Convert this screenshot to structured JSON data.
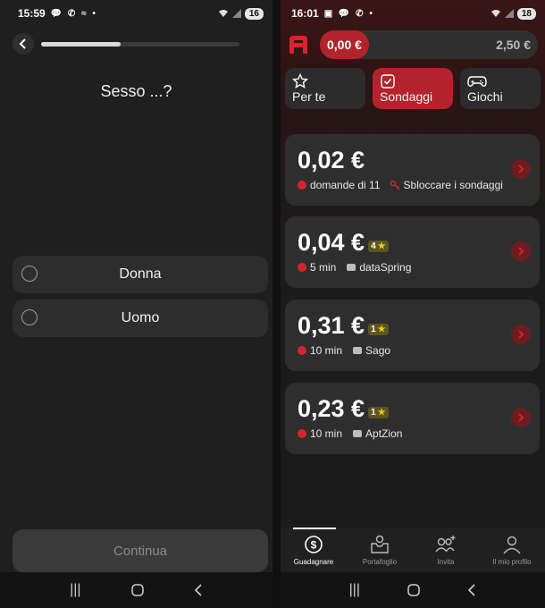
{
  "left_screen": {
    "status_bar": {
      "time": "15:59",
      "notifications": "💬 ✆ ≈ •",
      "battery": "16"
    },
    "progress_percent": 40,
    "question": "Sesso ...?",
    "options": [
      {
        "label": "Donna"
      },
      {
        "label": "Uomo"
      }
    ],
    "continue_label": "Continua"
  },
  "right_screen": {
    "status_bar": {
      "time": "16:01",
      "notifications": "▣ 💬 ✆ •",
      "battery": "18"
    },
    "balance_main": "0,00 €",
    "balance_secondary": "2,50 €",
    "tabs": [
      {
        "label": "Per te",
        "icon": "star-icon"
      },
      {
        "label": "Sondaggi",
        "icon": "checkbox-icon"
      },
      {
        "label": "Giochi",
        "icon": "gamepad-icon"
      }
    ],
    "surveys": [
      {
        "amount": "0,02 €",
        "meta1": "domande di 11",
        "meta2": "Sbloccare i sondaggi"
      },
      {
        "amount": "0,04 €",
        "rating": "4",
        "duration": "5 min",
        "provider": "dataSpring"
      },
      {
        "amount": "0,31 €",
        "rating": "1",
        "duration": "10 min",
        "provider": "Sago"
      },
      {
        "amount": "0,23 €",
        "rating": "1",
        "duration": "10 min",
        "provider": "AptZion"
      }
    ],
    "bottom_nav": [
      {
        "label": "Guadagnare"
      },
      {
        "label": "Portafoglio"
      },
      {
        "label": "Invita"
      },
      {
        "label": "Il mio profilo"
      }
    ]
  },
  "colors": {
    "accent_red": "#b2232c",
    "card_bg": "#2e2e2e",
    "rating_bg": "#5b5520"
  }
}
